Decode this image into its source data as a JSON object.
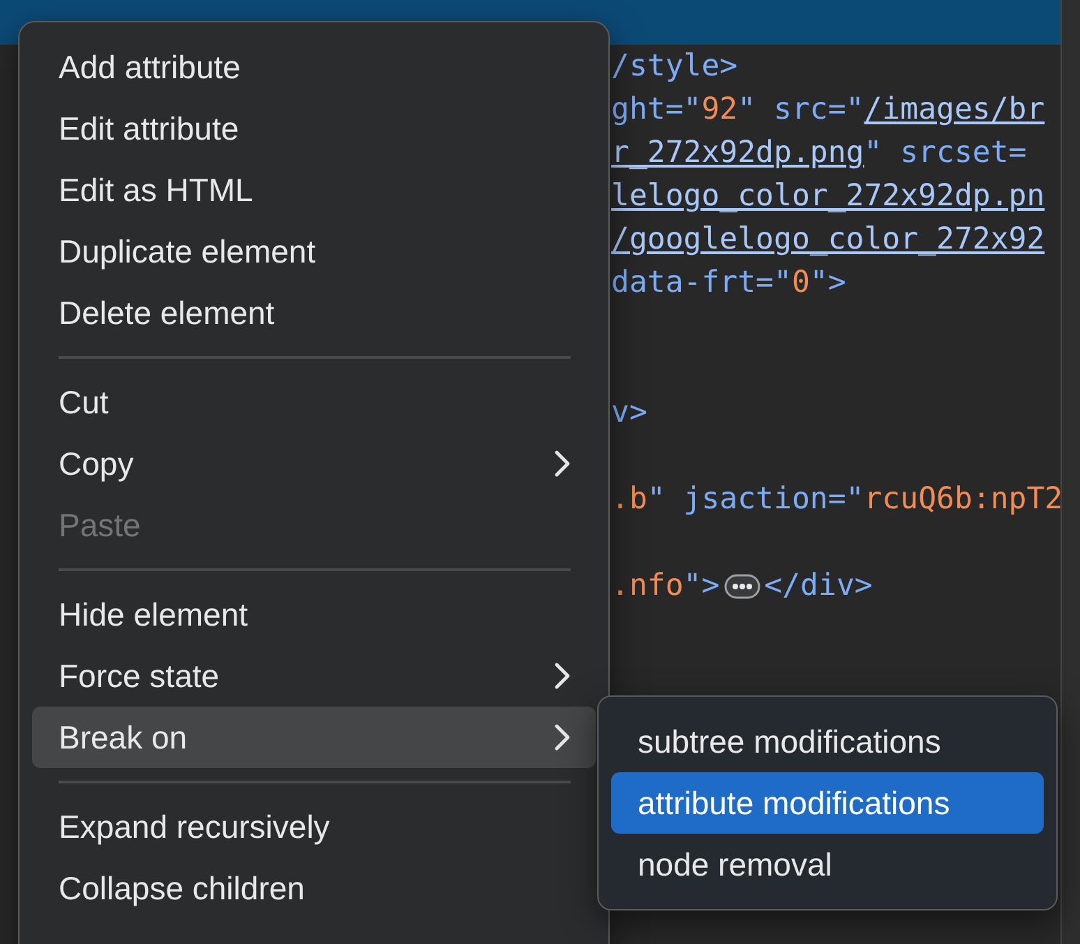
{
  "code_lines": [
    {
      "selected": true
    },
    {
      "selected": false,
      "segments": [
        {
          "kind": "tag",
          "text": "/style>"
        }
      ]
    },
    {
      "selected": false,
      "segments": [
        {
          "kind": "attr",
          "text": "ght=\""
        },
        {
          "kind": "value",
          "text": "92"
        },
        {
          "kind": "attr",
          "text": "\" src=\""
        },
        {
          "kind": "link",
          "text": "/images/br"
        }
      ]
    },
    {
      "selected": false,
      "segments": [
        {
          "kind": "link",
          "text": "r_272x92dp.png"
        },
        {
          "kind": "attr",
          "text": "\" srcset="
        }
      ]
    },
    {
      "selected": false,
      "segments": [
        {
          "kind": "link",
          "text": "lelogo_color_272x92dp.pn"
        }
      ]
    },
    {
      "selected": false,
      "segments": [
        {
          "kind": "link",
          "text": "/googlelogo_color_272x92"
        }
      ]
    },
    {
      "selected": false,
      "segments": [
        {
          "kind": "attr",
          "text": "data-frt=\""
        },
        {
          "kind": "value",
          "text": "0"
        },
        {
          "kind": "tag",
          "text": "\">"
        }
      ]
    },
    {
      "selected": false
    },
    {
      "selected": false
    },
    {
      "selected": false,
      "segments": [
        {
          "kind": "tag",
          "text": "v>"
        }
      ]
    },
    {
      "selected": false
    },
    {
      "selected": false,
      "segments": [
        {
          "kind": "value",
          "text": ".b"
        },
        {
          "kind": "attr",
          "text": "\" jsaction=\""
        },
        {
          "kind": "value",
          "text": "rcuQ6b:npT2"
        }
      ]
    },
    {
      "selected": false
    },
    {
      "selected": false,
      "segments": [
        {
          "kind": "value",
          "text": ".nfo"
        },
        {
          "kind": "tag",
          "text": "\">"
        },
        {
          "kind": "ellipsis"
        },
        {
          "kind": "tag",
          "text": "</div>"
        }
      ]
    }
  ],
  "context_menu": {
    "items": [
      {
        "kind": "item",
        "label": "Add attribute",
        "disabled": false,
        "submenu": false,
        "selected": false
      },
      {
        "kind": "item",
        "label": "Edit attribute",
        "disabled": false,
        "submenu": false,
        "selected": false
      },
      {
        "kind": "item",
        "label": "Edit as HTML",
        "disabled": false,
        "submenu": false,
        "selected": false
      },
      {
        "kind": "item",
        "label": "Duplicate element",
        "disabled": false,
        "submenu": false,
        "selected": false
      },
      {
        "kind": "item",
        "label": "Delete element",
        "disabled": false,
        "submenu": false,
        "selected": false
      },
      {
        "kind": "separator"
      },
      {
        "kind": "item",
        "label": "Cut",
        "disabled": false,
        "submenu": false,
        "selected": false
      },
      {
        "kind": "item",
        "label": "Copy",
        "disabled": false,
        "submenu": true,
        "selected": false
      },
      {
        "kind": "item",
        "label": "Paste",
        "disabled": true,
        "submenu": false,
        "selected": false
      },
      {
        "kind": "separator"
      },
      {
        "kind": "item",
        "label": "Hide element",
        "disabled": false,
        "submenu": false,
        "selected": false
      },
      {
        "kind": "item",
        "label": "Force state",
        "disabled": false,
        "submenu": true,
        "selected": false
      },
      {
        "kind": "item",
        "label": "Break on",
        "disabled": false,
        "submenu": true,
        "selected": true
      },
      {
        "kind": "separator"
      },
      {
        "kind": "item",
        "label": "Expand recursively",
        "disabled": false,
        "submenu": false,
        "selected": false
      },
      {
        "kind": "item",
        "label": "Collapse children",
        "disabled": false,
        "submenu": false,
        "selected": false
      }
    ]
  },
  "submenu": {
    "items": [
      {
        "label": "subtree modifications",
        "selected": false
      },
      {
        "label": "attribute modifications",
        "selected": true
      },
      {
        "label": "node removal",
        "selected": false
      }
    ]
  }
}
